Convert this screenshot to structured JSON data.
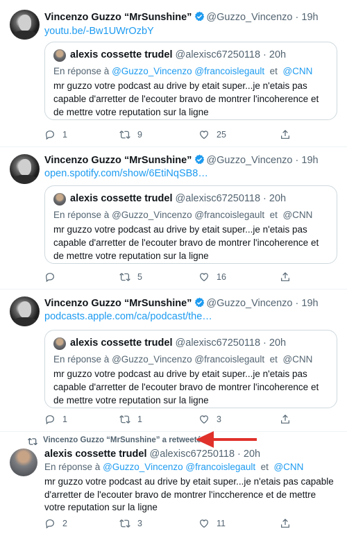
{
  "tweets": [
    {
      "name": "Vincenzo Guzzo “MrSunshine”",
      "handle": "@Guzzo_Vincenzo",
      "time": "19h",
      "link": "youtu.be/-Bw1UWrOzbY",
      "quote": {
        "name": "alexis cossette trudel",
        "handle": "@alexisc67250118",
        "time": "20h",
        "reply_prefix": "En réponse à",
        "mention1": "@Guzzo_Vincenzo",
        "mention2": "@francoislegault",
        "and": "et",
        "mention3": "@CNN",
        "body": "mr guzzo votre podcast au drive by etait super...je n'etais pas capable d'arretter de l'ecouter bravo de montrer l'incoherence et de mettre votre reputation sur la ligne"
      },
      "replies": "1",
      "retweets": "9",
      "likes": "25"
    },
    {
      "name": "Vincenzo Guzzo “MrSunshine”",
      "handle": "@Guzzo_Vincenzo",
      "time": "19h",
      "link": "open.spotify.com/show/6EtiNqSB8…",
      "quote": {
        "name": "alexis cossette trudel",
        "handle": "@alexisc67250118",
        "time": "20h",
        "reply_prefix": "En réponse à",
        "mention1": "@Guzzo_Vincenzo",
        "mention2": "@francoislegault",
        "and": "et",
        "mention3": "@CNN",
        "body": "mr guzzo votre podcast au drive by etait super...je n'etais pas capable d'arretter de l'ecouter bravo de montrer l'incoherence et de mettre votre reputation sur la ligne"
      },
      "replies": "",
      "retweets": "5",
      "likes": "16"
    },
    {
      "name": "Vincenzo Guzzo “MrSunshine”",
      "handle": "@Guzzo_Vincenzo",
      "time": "19h",
      "link": "podcasts.apple.com/ca/podcast/the…",
      "quote": {
        "name": "alexis cossette trudel",
        "handle": "@alexisc67250118",
        "time": "20h",
        "reply_prefix": "En réponse à",
        "mention1": "@Guzzo_Vincenzo",
        "mention2": "@francoislegault",
        "and": "et",
        "mention3": "@CNN",
        "body": "mr guzzo votre podcast au drive by etait super...je n'etais pas capable d'arretter de l'ecouter bravo de montrer l'incoherence et de mettre votre reputation sur la ligne"
      },
      "replies": "1",
      "retweets": "1",
      "likes": "3"
    }
  ],
  "retweet": {
    "banner": "Vincenzo Guzzo “MrSunshine” a retweeté",
    "name": "alexis cossette trudel",
    "handle": "@alexisc67250118",
    "time": "20h",
    "reply_prefix": "En réponse à",
    "mention1": "@Guzzo_Vincenzo",
    "mention2": "@francoislegault",
    "and": "et",
    "mention3": "@CNN",
    "body": "mr guzzo votre podcast au drive by etait super...je n'etais pas capable d'arretter de l'incoherence et de mettre votre reputation sur la ligne",
    "body_display": "mr guzzo votre podcast au drive by etait super...je n'etais pas capable d'arretter de l'ecouter bravo de montrer l'inccherence et de mettre votre reputation sur la ligne",
    "replies": "2",
    "retweets": "3",
    "likes": "11"
  },
  "icons": {
    "reply": "reply-icon",
    "retweet": "retweet-icon",
    "like": "heart-icon",
    "share": "share-icon",
    "verified": "verified-badge-icon"
  },
  "colors": {
    "link": "#1d9bf0",
    "secondary": "#536471",
    "verified": "#1d9bf0",
    "annotation_arrow": "#e0312b"
  }
}
